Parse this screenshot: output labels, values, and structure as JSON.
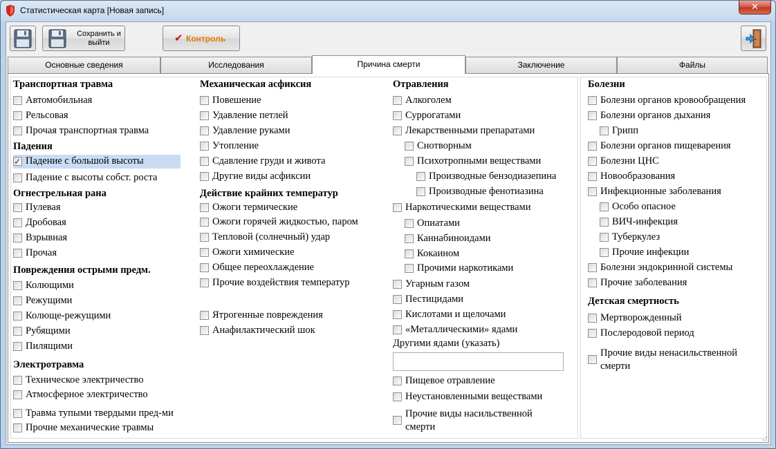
{
  "window": {
    "title": "Статистическая карта [Новая запись]",
    "close_glyph": "✕"
  },
  "toolbar": {
    "save_exit_label_1": "Сохранить и",
    "save_exit_label_2": "выйти",
    "control_label": "Контроль",
    "control_mark": "✔"
  },
  "tabs": [
    "Основные сведения",
    "Исследования",
    "Причина смерти",
    "Заключение",
    "Файлы"
  ],
  "active_tab": "Причина смерти",
  "col1": {
    "transport": {
      "title": "Транспортная травма",
      "items": [
        "Автомобильная",
        "Рельсовая",
        "Прочая транспортная травма"
      ]
    },
    "falls": {
      "title": "Падения",
      "items": [
        "Падение с большой высоты",
        "Падение с высоты собст. роста"
      ]
    },
    "gunshot": {
      "title": "Огнестрельная рана",
      "items": [
        "Пулевая",
        "Дробовая",
        "Взрывная",
        "Прочая"
      ]
    },
    "sharp": {
      "title": "Повреждения острыми предм.",
      "items": [
        "Колющими",
        "Режущими",
        "Колюще-режущими",
        "Рубящими",
        "Пилящими"
      ]
    },
    "electro": {
      "title": "Электротравма",
      "items": [
        "Техническое электричество",
        "Атмосферное электричество"
      ]
    },
    "other": [
      "Травма тупыми твердыми пред-ми",
      "Прочие механические травмы"
    ]
  },
  "col2": {
    "asphyxia": {
      "title": "Механическая асфиксия",
      "items": [
        "Повешение",
        "Удавление петлей",
        "Удавление руками",
        "Утопление",
        "Сдавление груди и живота",
        "Другие виды асфиксии"
      ]
    },
    "temp": {
      "title": "Действие крайних температур",
      "items": [
        "Ожоги термические",
        "Ожоги горячей жидкостью, паром",
        "Тепловой (солнечный) удар",
        "Ожоги химические",
        "Общее переохлаждение",
        "Прочие воздействия температур"
      ]
    },
    "other": [
      "Ятрогенные повреждения",
      "Анафилактический шок"
    ]
  },
  "col3": {
    "poison": {
      "title": "Отравления",
      "items": [
        "Алкоголем",
        "Суррогатами",
        "Лекарственными препаратами",
        "Снотворным",
        "Психотропными веществами",
        "Производные бензодиазепина",
        "Производные  фенотиазина",
        "Наркотическими веществами",
        "Опиатами",
        "Каннабиноидами",
        "Кокаином",
        "Прочими наркотиками",
        "Угарным газом",
        "Пестицидами",
        "Кислотами и щелочами",
        "«Металлическими» ядами"
      ]
    },
    "other_poison_label": "Другими ядами (указать)",
    "other_poison_value": "",
    "after": [
      "Пищевое отравление",
      "Неустановленными веществами"
    ],
    "violent_other": "Прочие виды насильственной смерти"
  },
  "col4": {
    "diseases": {
      "title": "Болезни",
      "items": [
        "Болезни органов кровообращения",
        "Болезни органов дыхания",
        "Грипп",
        "Болезни органов пищеварения",
        "Болезни ЦНС",
        "Новообразования",
        "Инфекционные заболевания",
        "Особо опасное",
        "ВИЧ-инфекция",
        "Туберкулез",
        "Прочие инфекции",
        "Болезни эндокринной системы",
        "Прочие заболевания"
      ]
    },
    "child": {
      "title": "Детская смертность",
      "items": [
        "Мертворожденный",
        "Послеродовой период"
      ]
    },
    "nonviolent_other": "Прочие виды ненасильственной смерти"
  },
  "checked": [
    "Падение с большой высоты"
  ],
  "colors": {
    "selection": "#c9dcf3",
    "control_text": "#e07a00",
    "check_mark": "#cc1010"
  }
}
